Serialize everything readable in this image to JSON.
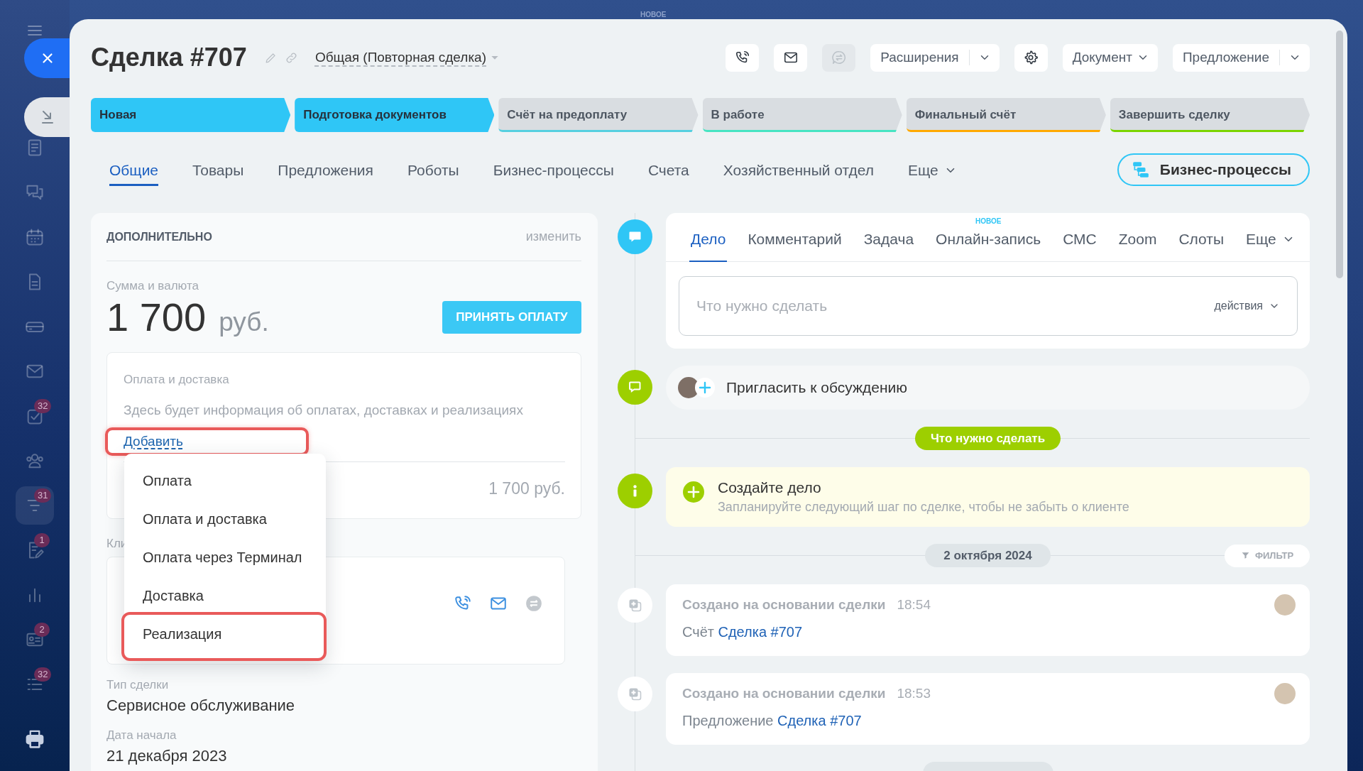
{
  "background": {
    "new_label": "НОВОЕ"
  },
  "sidebar": {
    "items": [
      {
        "selected": false
      },
      {
        "selected": false
      },
      {
        "selected": false
      },
      {
        "selected": false
      },
      {
        "selected": false
      },
      {
        "selected": false
      },
      {
        "selected": false,
        "badge": "32"
      },
      {
        "selected": false
      },
      {
        "selected": true,
        "badge": "31"
      },
      {
        "selected": false,
        "badge": "1"
      },
      {
        "selected": false
      },
      {
        "selected": false,
        "badge": "2"
      },
      {
        "selected": false,
        "badge": "32"
      }
    ]
  },
  "panel": {
    "title": "Сделка #707",
    "category": "Общая (Повторная сделка)",
    "toolbar": [
      {
        "kind": "icon",
        "disabled": false
      },
      {
        "kind": "icon",
        "disabled": false
      },
      {
        "kind": "icon",
        "disabled": true
      },
      {
        "kind": "split",
        "label": "Расширения"
      },
      {
        "kind": "icon",
        "disabled": false
      },
      {
        "kind": "dropdown",
        "label": "Документ"
      },
      {
        "kind": "split",
        "label": "Предложение"
      }
    ],
    "stages": [
      {
        "label": "Новая",
        "color": "#2fc6f6",
        "passed": true
      },
      {
        "label": "Подготовка документов",
        "color": "#2fc6f6",
        "passed": true
      },
      {
        "label": "Счёт на предоплату",
        "color": "#55d0e0",
        "passed": false
      },
      {
        "label": "В работе",
        "color": "#47e4c2",
        "passed": false
      },
      {
        "label": "Финальный счёт",
        "color": "#ffa900",
        "passed": false
      },
      {
        "label": "Завершить сделку",
        "color": "#7bd500",
        "passed": false
      }
    ],
    "tabs": [
      {
        "kind": "tab",
        "label": "Общие",
        "selected": true
      },
      {
        "kind": "tab",
        "label": "Товары",
        "selected": false
      },
      {
        "kind": "tab",
        "label": "Предложения",
        "selected": false
      },
      {
        "kind": "tab",
        "label": "Роботы",
        "selected": false
      },
      {
        "kind": "tab",
        "label": "Бизнес-процессы",
        "selected": false
      },
      {
        "kind": "tab",
        "label": "Счета",
        "selected": false
      },
      {
        "kind": "tab",
        "label": "Хозяйственный отдел",
        "selected": false
      },
      {
        "kind": "more",
        "label": "Еще",
        "selected": false
      }
    ],
    "process_button": "Бизнес-процессы"
  },
  "details": {
    "title": "ДОПОЛНИТЕЛЬНО",
    "edit_link": "изменить",
    "amount_label": "Сумма и валюта",
    "amount": "1 700",
    "currency": "руб.",
    "pay_button": "ПРИНЯТЬ ОПЛАТУ",
    "payments": {
      "title": "Оплата и доставка",
      "hint": "Здесь будет информация об оплатах, доставках и реализациях",
      "add_link": {
        "label": "Добавить",
        "highlighted": true
      },
      "total": "1 700 руб."
    },
    "client_label": "Кли",
    "fields": [
      {
        "label": "Тип сделки",
        "value": "Сервисное обслуживание"
      },
      {
        "label": "Дата начала",
        "value": "21 декабря 2023"
      }
    ]
  },
  "add_menu": {
    "items": [
      {
        "label": "Оплата",
        "highlighted": false
      },
      {
        "label": "Оплата и доставка",
        "highlighted": false
      },
      {
        "label": "Оплата через Терминал",
        "highlighted": false
      },
      {
        "label": "Доставка",
        "highlighted": false
      },
      {
        "label": "Реализация",
        "highlighted": true
      }
    ]
  },
  "timeline": {
    "editor": {
      "tabs": [
        {
          "kind": "tab",
          "label": "Дело",
          "selected": true
        },
        {
          "kind": "tab",
          "label": "Комментарий",
          "selected": false
        },
        {
          "kind": "tab",
          "label": "Задача",
          "selected": false
        },
        {
          "kind": "tab",
          "label": "Онлайн-запись",
          "selected": false,
          "badge": "НОВОЕ"
        },
        {
          "kind": "tab",
          "label": "СМС",
          "selected": false
        },
        {
          "kind": "tab",
          "label": "Zoom",
          "selected": false
        },
        {
          "kind": "tab",
          "label": "Слоты",
          "selected": false
        },
        {
          "kind": "more",
          "label": "Еще",
          "selected": false
        }
      ],
      "placeholder": "Что нужно сделать",
      "actions": "действия"
    },
    "invite": "Пригласить к обсуждению",
    "section_label": "Что нужно сделать",
    "hint": {
      "title": "Создайте дело",
      "text": "Запланируйте следующий шаг по сделке, чтобы не забыть о клиенте"
    },
    "date": "2 октября 2024",
    "filter": "ФИЛЬТР",
    "events": [
      {
        "title": "Создано на основании сделки",
        "time": "18:54",
        "text": "Счёт",
        "link": "Сделка #707"
      },
      {
        "title": "Создано на основании сделки",
        "time": "18:53",
        "text": "Предложение",
        "link": "Сделка #707"
      }
    ]
  }
}
